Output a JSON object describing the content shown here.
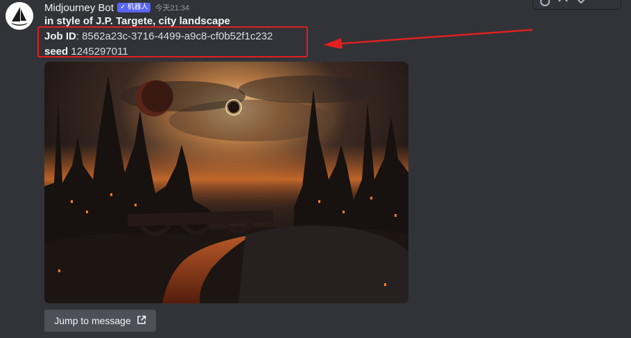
{
  "message": {
    "author": "Midjourney Bot",
    "bot_tag": "机器人",
    "timestamp": "今天21:34",
    "prompt_line": "in style of J.P. Targete, city landscape",
    "job_label": "Job ID",
    "job_value": ": 8562a23c-3716-4499-a9c8-cf0b52f1c232",
    "seed_label": "seed",
    "seed_value": " 1245297011",
    "jump_button": "Jump to message"
  },
  "colors": {
    "background": "#313338",
    "bot_tag": "#5865f2",
    "highlight": "#e11f1f",
    "button": "#4e5058"
  },
  "icons": [
    "emoji-reaction-icon",
    "reply-icon",
    "forward-icon",
    "external-link-icon",
    "checkmark-icon"
  ]
}
